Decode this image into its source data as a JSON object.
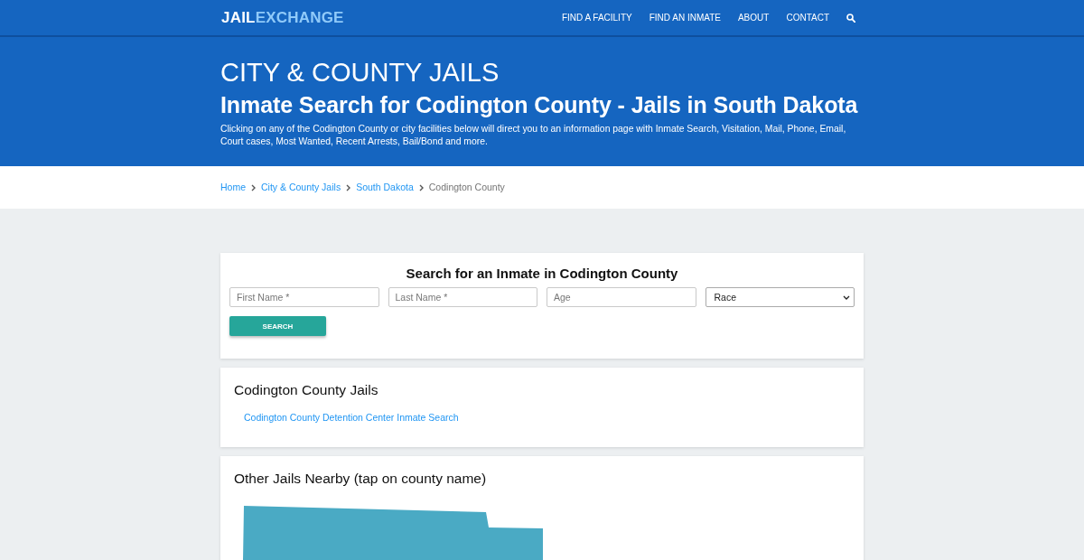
{
  "header": {
    "logo": {
      "first": "JAIL",
      "second": "EXCHANGE"
    },
    "nav": [
      "FIND A FACILITY",
      "FIND AN INMATE",
      "ABOUT",
      "CONTACT"
    ]
  },
  "hero": {
    "title": "CITY & COUNTY JAILS",
    "subtitle": "Inmate Search for Codington County - Jails in South Dakota",
    "description": "Clicking on any of the Codington County or city facilities below will direct you to an information page with Inmate Search, Visitation, Mail, Phone, Email, Court cases, Most Wanted, Recent Arrests, Bail/Bond and more."
  },
  "breadcrumb": [
    {
      "label": "Home",
      "kind": "link"
    },
    {
      "label": "City & County Jails",
      "kind": "link"
    },
    {
      "label": "South Dakota",
      "kind": "link"
    },
    {
      "label": "Codington County",
      "kind": "current"
    }
  ],
  "search_form": {
    "title": "Search for an Inmate in Codington County",
    "fields": [
      {
        "kind": "input",
        "placeholder": "First Name *"
      },
      {
        "kind": "input",
        "placeholder": "Last Name *"
      },
      {
        "kind": "input",
        "placeholder": "Age"
      },
      {
        "kind": "select",
        "value": "Race"
      }
    ],
    "button": "SEARCH"
  },
  "jails_card": {
    "title": "Codington County Jails",
    "links": [
      "Codington County Detention Center Inmate Search"
    ]
  },
  "nearby_card": {
    "title": "Other Jails Nearby (tap on county name)"
  }
}
